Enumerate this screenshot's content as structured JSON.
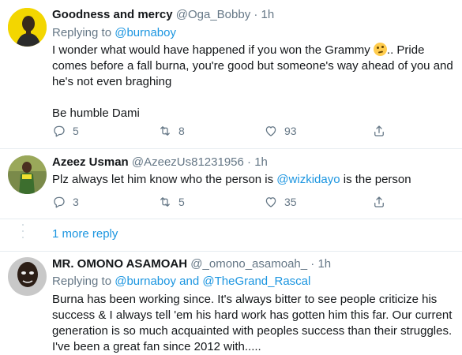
{
  "tweets": [
    {
      "name": "Goodness and mercy",
      "handle": "@Oga_Bobby",
      "sep": "·",
      "time": "1h",
      "replying_label": "Replying to",
      "replying_to": [
        "@burnaboy"
      ],
      "text_line1": "I wonder what would have happened if you won the Grammy",
      "emoji": "thinking-face",
      "text_line1_tail": ".. Pride",
      "text_line2": "comes before a fall burna, you're good but someone's way ahead of you and",
      "text_line3": "he's not even braghing",
      "text_line4": "Be humble Dami",
      "replies": "5",
      "retweets": "8",
      "likes": "93"
    },
    {
      "name": "Azeez Usman",
      "handle": "@AzeezUs81231956",
      "sep": "·",
      "time": "1h",
      "text_before": "Plz always let him know who the person is ",
      "mention": "@wizkidayo",
      "text_after": " is the person",
      "replies": "3",
      "retweets": "5",
      "likes": "35"
    },
    {
      "name": "MR. OMONO ASAMOAH",
      "handle": "@_omono_asamoah_",
      "sep": "·",
      "time": "1h",
      "replying_label": "Replying to",
      "replying_to": [
        "@burnaboy",
        "and",
        "@TheGrand_Rascal"
      ],
      "text_line1": "Burna has been working since. It's always bitter to see people criticize his",
      "text_line2": "success & I always tell 'em his hard work has gotten him this far. Our current",
      "text_line3": "generation is so much acquainted with peoples success than their struggles.",
      "text_line4": "I've been a great fan since 2012 with....."
    }
  ],
  "more_replies": "1 more reply",
  "colors": {
    "link": "#1b95e0",
    "secondary": "#657786",
    "text": "#14171a",
    "border": "#e6ecf0"
  }
}
